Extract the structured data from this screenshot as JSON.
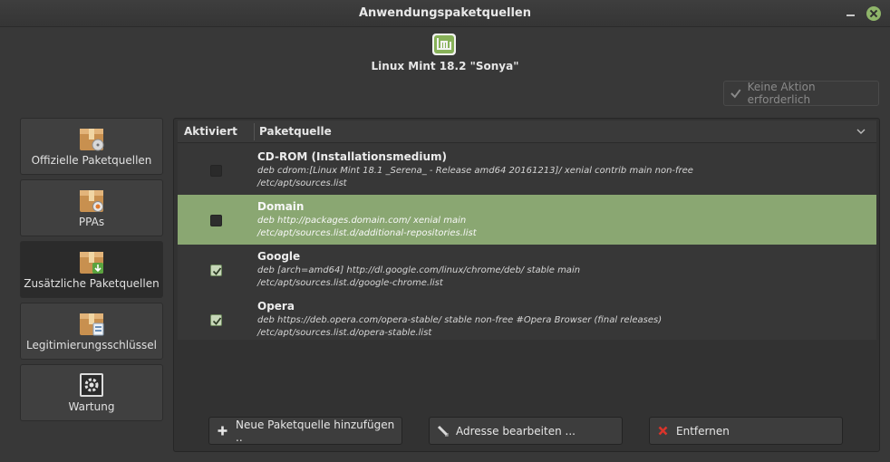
{
  "window": {
    "title": "Anwendungspaketquellen"
  },
  "header": {
    "distro_label": "Linux Mint 18.2 \"Sonya\""
  },
  "status_button": {
    "label": "Keine Aktion erforderlich",
    "enabled": false
  },
  "sidebar": {
    "items": [
      {
        "label": "Offizielle Paketquellen",
        "icon": "package-cd-icon",
        "active": false
      },
      {
        "label": "PPAs",
        "icon": "package-ppa-icon",
        "active": false
      },
      {
        "label": "Zusätzliche Paketquellen",
        "icon": "package-download-icon",
        "active": true
      },
      {
        "label": "Legitimierungsschlüssel",
        "icon": "package-key-icon",
        "active": false
      },
      {
        "label": "Wartung",
        "icon": "maintenance-gear-icon",
        "active": false
      }
    ]
  },
  "table": {
    "columns": [
      "Aktiviert",
      "Paketquelle"
    ],
    "rows": [
      {
        "enabled": false,
        "selected": false,
        "name": "CD-ROM (Installationsmedium)",
        "line": "deb cdrom:[Linux Mint 18.1 _Serena_ - Release amd64 20161213]/ xenial contrib main non-free",
        "file": "/etc/apt/sources.list"
      },
      {
        "enabled": false,
        "selected": true,
        "name": "Domain",
        "line": "deb http://packages.domain.com/ xenial main",
        "file": "/etc/apt/sources.list.d/additional-repositories.list"
      },
      {
        "enabled": true,
        "selected": false,
        "name": "Google",
        "line": "deb [arch=amd64] http://dl.google.com/linux/chrome/deb/ stable main",
        "file": "/etc/apt/sources.list.d/google-chrome.list"
      },
      {
        "enabled": true,
        "selected": false,
        "name": "Opera",
        "line": "deb https://deb.opera.com/opera-stable/ stable non-free #Opera Browser (final releases)",
        "file": "/etc/apt/sources.list.d/opera-stable.list"
      }
    ]
  },
  "actions": {
    "add": "Neue Paketquelle hinzufügen ..",
    "edit": "Adresse bearbeiten ...",
    "remove": "Entfernen"
  },
  "colors": {
    "accent": "#8aa772",
    "window_bg": "#383838",
    "remove_icon": "#d9342b"
  }
}
